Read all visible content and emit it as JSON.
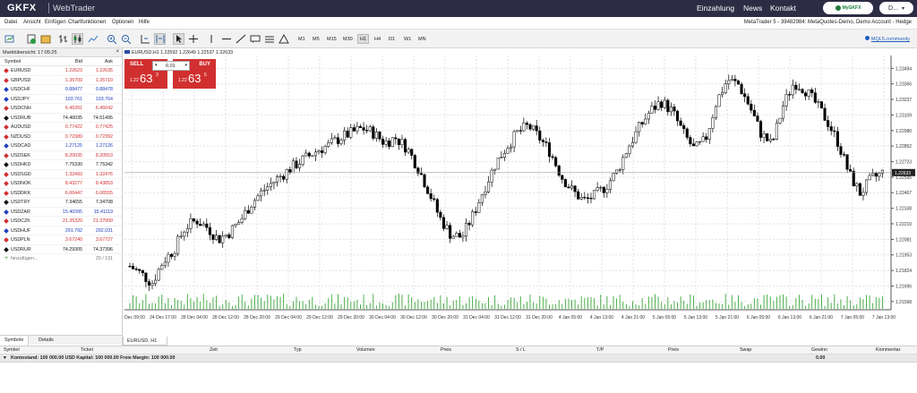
{
  "topbar": {
    "logo": "GKFX",
    "product": "WebTrader",
    "nav": [
      "Einzahlung",
      "News",
      "Kontakt"
    ],
    "mygkfx_label": "MyGKFX",
    "user_label": "D..."
  },
  "menu": {
    "items": [
      "Datei",
      "Ansicht",
      "Einfügen",
      "Chartfunktionen",
      "Optionen",
      "Hilfe"
    ],
    "account_info": "MetaTrader 5 - 39482984: MetaQuotes-Demo, Demo Account - Hedge"
  },
  "toolbar": {
    "timeframes": [
      "M1",
      "M5",
      "M15",
      "M30",
      "H1",
      "H4",
      "D1",
      "W1",
      "MN"
    ],
    "active_timeframe": "H1",
    "mql_link": "MQL5.community"
  },
  "market_watch": {
    "title": "Marktübersicht: 17:05:25",
    "headers": {
      "symbol": "Symbol",
      "bid": "Bid",
      "ask": "Ask"
    },
    "rows": [
      {
        "symbol": "EURUSD",
        "bid": "1.22623",
        "ask": "1.22635",
        "color": "#d12f2f"
      },
      {
        "symbol": "GBPUSD",
        "bid": "1.35709",
        "ask": "1.35710",
        "color": "#d12f2f"
      },
      {
        "symbol": "USDCHF",
        "bid": "0.88477",
        "ask": "0.88478",
        "color": "#1f3fbf"
      },
      {
        "symbol": "USDJPY",
        "bid": "103.761",
        "ask": "103.764",
        "color": "#1f3fbf"
      },
      {
        "symbol": "USDCNH",
        "bid": "6.46391",
        "ask": "6.46642",
        "color": "#d12f2f"
      },
      {
        "symbol": "USDRUB",
        "bid": "74.46035",
        "ask": "74.51495",
        "color": "#111111"
      },
      {
        "symbol": "AUDUSD",
        "bid": "0.77422",
        "ask": "0.77425",
        "color": "#d12f2f"
      },
      {
        "symbol": "NZDUSD",
        "bid": "0.72389",
        "ask": "0.72392",
        "color": "#d12f2f"
      },
      {
        "symbol": "USDCAD",
        "bid": "1.27125",
        "ask": "1.27126",
        "color": "#1f3fbf"
      },
      {
        "symbol": "USDSEK",
        "bid": "8.20035",
        "ask": "8.20553",
        "color": "#d12f2f"
      },
      {
        "symbol": "USDHKD",
        "bid": "7.75330",
        "ask": "7.75342",
        "color": "#111111"
      },
      {
        "symbol": "USDSGD",
        "bid": "1.32493",
        "ask": "1.32476",
        "color": "#d12f2f"
      },
      {
        "symbol": "USDNOK",
        "bid": "8.43277",
        "ask": "8.43853",
        "color": "#d12f2f"
      },
      {
        "symbol": "USDDKK",
        "bid": "6.06447",
        "ask": "6.06555",
        "color": "#d12f2f"
      },
      {
        "symbol": "USDTRY",
        "bid": "7.34655",
        "ask": "7.34708",
        "color": "#111111"
      },
      {
        "symbol": "USDZAR",
        "bid": "15.40395",
        "ask": "15.41119",
        "color": "#1f3fbf"
      },
      {
        "symbol": "USDCZK",
        "bid": "21.35320",
        "ask": "21.37000",
        "color": "#d12f2f"
      },
      {
        "symbol": "USDHUF",
        "bid": "291.792",
        "ask": "292.031",
        "color": "#1f3fbf"
      },
      {
        "symbol": "USDPLN",
        "bid": "3.67240",
        "ask": "3.67727",
        "color": "#d12f2f"
      },
      {
        "symbol": "USDRUR",
        "bid": "74.29305",
        "ask": "74.37396",
        "color": "#111111"
      }
    ],
    "add_label": "hinzufügen...",
    "count": "20 / 131",
    "tabs": [
      "Symbole",
      "Details"
    ]
  },
  "chart": {
    "header": "EURUSD,H1  1.22592 1.22649 1.22537 1.22633",
    "sell_label": "SELL",
    "buy_label": "BUY",
    "lot": "0.01",
    "sell_price_small": "1.22",
    "sell_price_big": "63",
    "sell_price_sup": "3",
    "buy_price_small": "1.22",
    "buy_price_big": "63",
    "buy_price_sup": "5",
    "tab_label": "EURUSD, H1"
  },
  "chart_data": {
    "type": "candlestick",
    "symbol": "EURUSD",
    "timeframe": "H1",
    "y_ticks": [
      "1.23494",
      "1.23366",
      "1.23237",
      "1.23109",
      "1.22980",
      "1.22852",
      "1.22723",
      "1.22595",
      "1.22467",
      "1.22338",
      "1.22210",
      "1.22081",
      "1.21953",
      "1.21824",
      "1.21696",
      "1.21568"
    ],
    "ylim": [
      1.215,
      1.236
    ],
    "current_price": "1.22633",
    "x_ticks": [
      "24 Dec 09:00",
      "24 Dec 17:00",
      "28 Dec 04:00",
      "28 Dec 12:00",
      "28 Dec 20:00",
      "29 Dec 04:00",
      "29 Dec 12:00",
      "29 Dec 20:00",
      "30 Dec 04:00",
      "30 Dec 12:00",
      "30 Dec 20:00",
      "31 Dec 04:00",
      "31 Dec 12:00",
      "31 Dec 20:00",
      "4 Jan 05:00",
      "4 Jan 13:00",
      "4 Jan 21:00",
      "5 Jan 05:00",
      "5 Jan 13:00",
      "5 Jan 21:00",
      "6 Jan 05:00",
      "6 Jan 13:00",
      "6 Jan 21:00",
      "7 Jan 05:00",
      "7 Jan 13:00"
    ],
    "close_path": [
      1.2186,
      1.218,
      1.2172,
      1.219,
      1.22,
      1.2218,
      1.2224,
      1.2218,
      1.2208,
      1.2214,
      1.2224,
      1.2238,
      1.2248,
      1.2256,
      1.2263,
      1.227,
      1.2276,
      1.2282,
      1.2286,
      1.2292,
      1.2296,
      1.23,
      1.2296,
      1.2288,
      1.2292,
      1.2284,
      1.2268,
      1.2248,
      1.2226,
      1.2212,
      1.221,
      1.2228,
      1.225,
      1.227,
      1.2284,
      1.2296,
      1.2302,
      1.2292,
      1.228,
      1.226,
      1.2248,
      1.224,
      1.2244,
      1.2252,
      1.2264,
      1.2284,
      1.23,
      1.2314,
      1.2322,
      1.2314,
      1.2296,
      1.2282,
      1.229,
      1.2322,
      1.234,
      1.2336,
      1.2318,
      1.2296,
      1.2286,
      1.2318,
      1.2338,
      1.2332,
      1.232,
      1.2306,
      1.2288,
      1.2262,
      1.2246,
      1.2258,
      1.2263
    ]
  },
  "terminal": {
    "headers": [
      "Symbol",
      "Ticket",
      "Zeit",
      "Typ",
      "Volumen",
      "Preis",
      "S / L",
      "T/P",
      "Preis",
      "Swap",
      "Gewinn",
      "Kommentar"
    ],
    "balance": "Kontostand: 100 000.00 USD  Kapital: 100 000.00  Freie Margin: 100 000.00",
    "profit": "0.00"
  }
}
